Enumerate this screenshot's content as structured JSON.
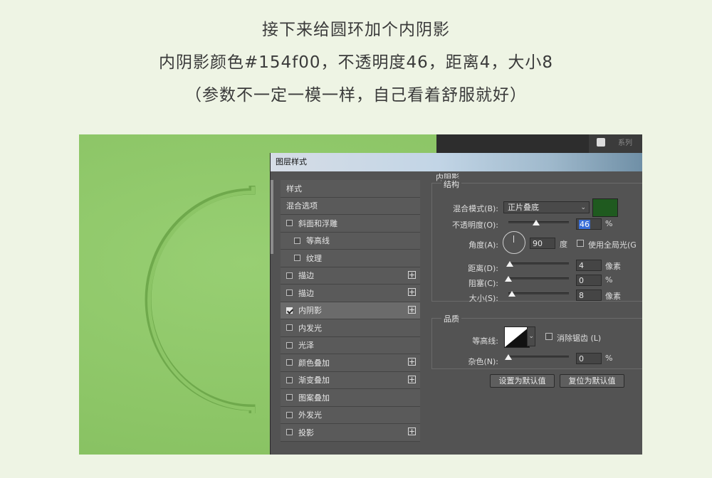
{
  "heading": {
    "line1": "接下来给圆环加个内阴影",
    "line2": "内阴影颜色#154f00，不透明度46，距离4，大小8",
    "line3": "（参数不一定一模一样，自己看着舒服就好）"
  },
  "background_panel": {
    "label": "系列"
  },
  "dialog": {
    "title": "图层样式",
    "styles": [
      {
        "label": "样式",
        "has_checkbox": false,
        "checked": false,
        "indent": false,
        "has_plus": false
      },
      {
        "label": "混合选项",
        "has_checkbox": false,
        "checked": false,
        "indent": false,
        "has_plus": false
      },
      {
        "label": "斜面和浮雕",
        "has_checkbox": true,
        "checked": false,
        "indent": false,
        "has_plus": false
      },
      {
        "label": "等高线",
        "has_checkbox": true,
        "checked": false,
        "indent": true,
        "has_plus": false
      },
      {
        "label": "纹理",
        "has_checkbox": true,
        "checked": false,
        "indent": true,
        "has_plus": false
      },
      {
        "label": "描边",
        "has_checkbox": true,
        "checked": false,
        "indent": false,
        "has_plus": true
      },
      {
        "label": "描边",
        "has_checkbox": true,
        "checked": false,
        "indent": false,
        "has_plus": true
      },
      {
        "label": "内阴影",
        "has_checkbox": true,
        "checked": true,
        "indent": false,
        "has_plus": true,
        "selected": true
      },
      {
        "label": "内发光",
        "has_checkbox": true,
        "checked": false,
        "indent": false,
        "has_plus": false
      },
      {
        "label": "光泽",
        "has_checkbox": true,
        "checked": false,
        "indent": false,
        "has_plus": false
      },
      {
        "label": "颜色叠加",
        "has_checkbox": true,
        "checked": false,
        "indent": false,
        "has_plus": true
      },
      {
        "label": "渐变叠加",
        "has_checkbox": true,
        "checked": false,
        "indent": false,
        "has_plus": true
      },
      {
        "label": "图案叠加",
        "has_checkbox": true,
        "checked": false,
        "indent": false,
        "has_plus": false
      },
      {
        "label": "外发光",
        "has_checkbox": true,
        "checked": false,
        "indent": false,
        "has_plus": false
      },
      {
        "label": "投影",
        "has_checkbox": true,
        "checked": false,
        "indent": false,
        "has_plus": true
      }
    ],
    "inner_shadow": {
      "section_title": "内阴影",
      "structure_title": "结构",
      "blend_mode_label": "混合模式(B):",
      "blend_mode_value": "正片叠底",
      "shadow_color": "#1f5a1f",
      "opacity_label": "不透明度(O):",
      "opacity_value": "46",
      "opacity_fraction": 0.46,
      "percent": "%",
      "angle_label": "角度(A):",
      "angle_value": "90",
      "degree": "度",
      "global_light_label": "使用全局光(G",
      "distance_label": "距离(D):",
      "distance_value": "4",
      "distance_fraction": 0.02,
      "choke_label": "阻塞(C):",
      "choke_value": "0",
      "choke_fraction": 0.0,
      "size_label": "大小(S):",
      "size_value": "8",
      "size_fraction": 0.06,
      "pixels": "像素",
      "quality_title": "品质",
      "contour_label": "等高线:",
      "anti_alias_label": "消除锯齿 (L)",
      "noise_label": "杂色(N):",
      "noise_value": "0",
      "noise_fraction": 0.0,
      "make_default_label": "设置为默认值",
      "reset_default_label": "复位为默认值"
    }
  }
}
